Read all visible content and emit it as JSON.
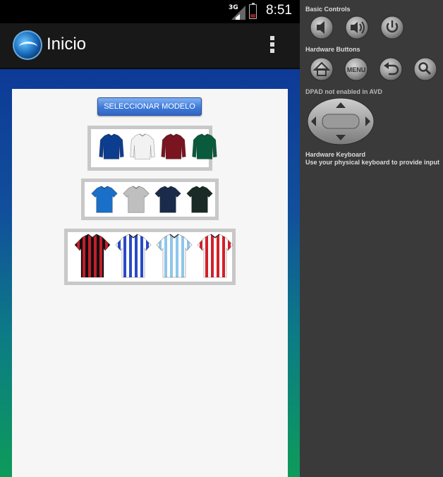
{
  "status_bar": {
    "network": "3G",
    "time": "8:51"
  },
  "action_bar": {
    "title": "Inicio",
    "logo_icon": "app-logo-icon",
    "overflow_icon": "overflow-menu-icon"
  },
  "main": {
    "select_button_label": "SELECCIONAR MODELO",
    "rows": [
      {
        "style": "long-sleeve",
        "colors": [
          "#0d3d8f",
          "#f2f2f2",
          "#7a1420",
          "#0a5a3c"
        ]
      },
      {
        "style": "short-sleeve",
        "colors": [
          "#1a6fc9",
          "#bfbfbf",
          "#1a2a4a",
          "#1a2a26"
        ]
      },
      {
        "style": "striped",
        "items": [
          {
            "base": "#111111",
            "stripe": "#c41e2a"
          },
          {
            "base": "#ffffff",
            "stripe": "#2a49c8"
          },
          {
            "base": "#ffffff",
            "stripe": "#8ec6ea"
          },
          {
            "base": "#ffffff",
            "stripe": "#d3202a"
          }
        ]
      }
    ]
  },
  "controls": {
    "basic_title": "Basic Controls",
    "hardware_title": "Hardware Buttons",
    "menu_label": "MENU",
    "dpad_note": "DPAD not enabled in AVD",
    "keyboard_title": "Hardware Keyboard",
    "keyboard_note": "Use your physical keyboard to provide input"
  }
}
